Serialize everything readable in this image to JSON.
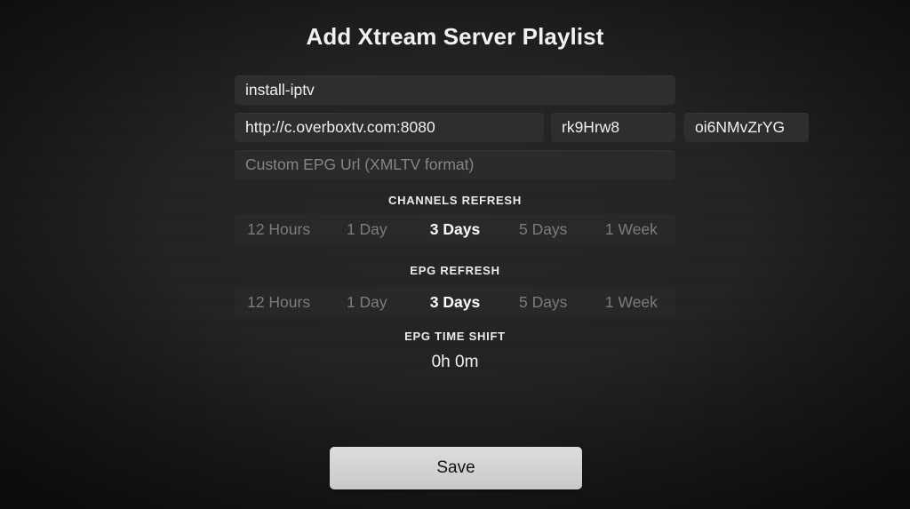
{
  "screen": {
    "title": "Add Xtream Server Playlist",
    "background_color": "#1e1e1e"
  },
  "form": {
    "playlist_name": {
      "value": "install-iptv",
      "placeholder": ""
    },
    "server_url": {
      "value": "http://c.overboxtv.com:8080",
      "placeholder": ""
    },
    "username": {
      "value": "rk9Hrw8",
      "placeholder": ""
    },
    "password": {
      "value": "oi6NMvZrYG",
      "placeholder": ""
    },
    "epg_url": {
      "value": "",
      "placeholder": "Custom EPG Url (XMLTV format)"
    }
  },
  "channels_refresh": {
    "label": "CHANNELS REFRESH",
    "options": [
      {
        "label": "12 Hours",
        "selected": false
      },
      {
        "label": "1 Day",
        "selected": false
      },
      {
        "label": "3 Days",
        "selected": true
      },
      {
        "label": "5 Days",
        "selected": false
      },
      {
        "label": "1 Week",
        "selected": false
      }
    ],
    "selected": "3 Days"
  },
  "epg_refresh": {
    "label": "EPG REFRESH",
    "options": [
      {
        "label": "12 Hours",
        "selected": false
      },
      {
        "label": "1 Day",
        "selected": false
      },
      {
        "label": "3 Days",
        "selected": true
      },
      {
        "label": "5 Days",
        "selected": false
      },
      {
        "label": "1 Week",
        "selected": false
      }
    ],
    "selected": "3 Days"
  },
  "epg_time_shift": {
    "label": "EPG TIME SHIFT",
    "value": "0h 0m"
  },
  "actions": {
    "save_label": "Save"
  },
  "colors": {
    "background": "#1e1e1e",
    "field_background": "#2e2e2e",
    "text_primary": "#f2f2f2",
    "text_muted": "#7c7c7c",
    "save_button": "#d2d2d2"
  }
}
